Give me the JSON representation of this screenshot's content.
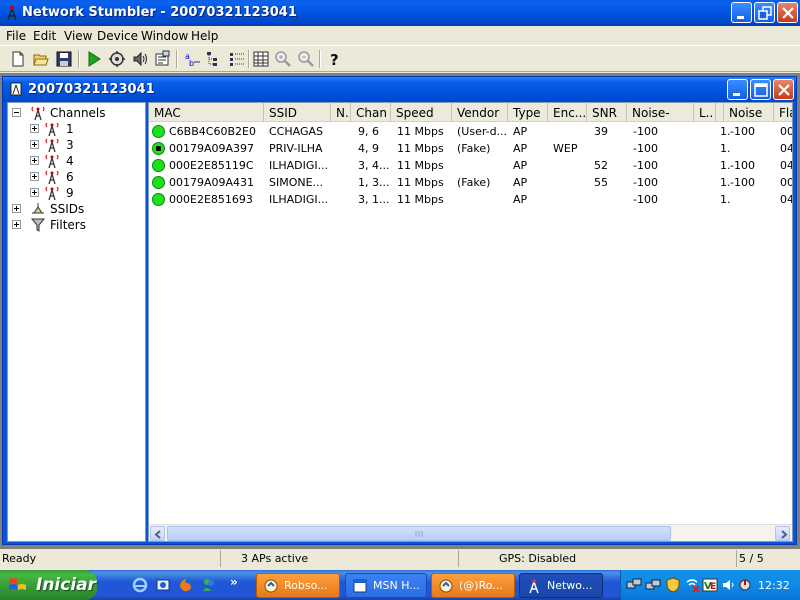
{
  "window": {
    "title": "Network Stumbler - 20070321123041"
  },
  "menu": [
    "File",
    "Edit",
    "View",
    "Device",
    "Window",
    "Help"
  ],
  "toolbar": {
    "buttons": [
      "new-icon",
      "open-icon",
      "save-icon",
      "play-icon",
      "auto-config-icon",
      "sound-icon",
      "properties-icon",
      "sort-icon",
      "tree-icon",
      "list-icon",
      "grid-icon",
      "zoom-in-icon",
      "zoom-out-icon",
      "help-icon"
    ]
  },
  "document": {
    "title": "20070321123041"
  },
  "tree": {
    "channels_label": "Channels",
    "channels": [
      "1",
      "3",
      "4",
      "6",
      "9"
    ],
    "ssids_label": "SSIDs",
    "filters_label": "Filters"
  },
  "list": {
    "columns": [
      "MAC",
      "SSID",
      "N..",
      "Chan",
      "Speed",
      "Vendor",
      "Type",
      "Enc...",
      "SNR",
      "Noise-",
      "L..",
      "Noise",
      "Fla"
    ],
    "rows": [
      {
        "mac": "C6BB4C60B2E0",
        "ssid": "CCHAGAS",
        "n": "",
        "chan": "9, 6",
        "speed": "11 Mbps",
        "vendor": "(User-d...",
        "type": "AP",
        "enc": "",
        "snr": "39",
        "noise_minus": "-100",
        "l": "1.",
        "noise": "-100",
        "flags": "00",
        "locked": false
      },
      {
        "mac": "00179A09A397",
        "ssid": "PRIV-ILHA",
        "n": "",
        "chan": "4, 9",
        "speed": "11 Mbps",
        "vendor": "(Fake)",
        "type": "AP",
        "enc": "WEP",
        "snr": "",
        "noise_minus": "-100",
        "l": "1.",
        "noise": "",
        "flags": "04",
        "locked": true
      },
      {
        "mac": "000E2E85119C",
        "ssid": "ILHADIGI...",
        "n": "",
        "chan": "3, 4...",
        "speed": "11 Mbps",
        "vendor": "",
        "type": "AP",
        "enc": "",
        "snr": "52",
        "noise_minus": "-100",
        "l": "1.",
        "noise": "-100",
        "flags": "04",
        "locked": false
      },
      {
        "mac": "00179A09A431",
        "ssid": "SIMONE...",
        "n": "",
        "chan": "1, 3...",
        "speed": "11 Mbps",
        "vendor": "(Fake)",
        "type": "AP",
        "enc": "",
        "snr": "55",
        "noise_minus": "-100",
        "l": "1.",
        "noise": "-100",
        "flags": "00",
        "locked": false
      },
      {
        "mac": "000E2E851693",
        "ssid": "ILHADIGI...",
        "n": "",
        "chan": "3, 1...",
        "speed": "11 Mbps",
        "vendor": "",
        "type": "AP",
        "enc": "",
        "snr": "",
        "noise_minus": "-100",
        "l": "1.",
        "noise": "",
        "flags": "04",
        "locked": false
      }
    ]
  },
  "status": {
    "ready": "Ready",
    "aps": "3 APs active",
    "gps": "GPS: Disabled",
    "count": "5 / 5"
  },
  "taskbar": {
    "start": "Iniciar",
    "quicklaunch_more": "»",
    "tasks": [
      "Robso...",
      "MSN H...",
      "(@)Ro...",
      "Netwo..."
    ],
    "clock": "12:32"
  },
  "colors": {
    "xp_blue": "#0053e1",
    "start_green": "#359a35",
    "tray_blue": "#0f8be6",
    "active_dot": "#1ee01e"
  }
}
